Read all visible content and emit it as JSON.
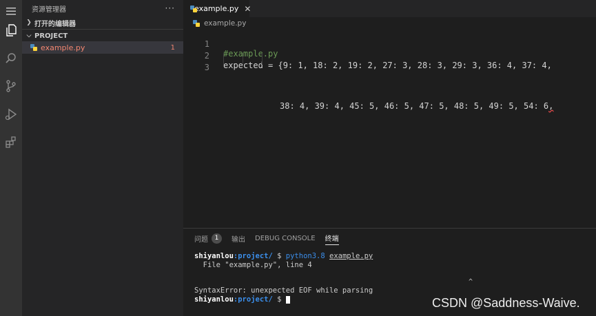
{
  "activity_bar": {
    "icons": [
      "menu-icon",
      "files-icon",
      "search-icon",
      "source-control-icon",
      "run-debug-icon",
      "extensions-icon"
    ]
  },
  "sidebar": {
    "title": "资源管理器",
    "more": "···",
    "open_editors_label": "打开的编辑器",
    "project_label": "PROJECT",
    "file": {
      "name": "example.py",
      "problem_count": "1"
    }
  },
  "tab": {
    "label": "example.py",
    "close": "✕"
  },
  "breadcrumb": {
    "label": "example.py"
  },
  "editor": {
    "lines": [
      {
        "number": "1",
        "text": "#example.py"
      },
      {
        "number": "2",
        "text": "expected = {9: 1, 18: 2, 19: 2, 27: 3, 28: 3, 29: 3, 36: 4, 37: 4,"
      },
      {
        "number": "3",
        "text": "38: 4, 39: 4, 45: 5, 46: 5, 47: 5, 48: 5, 49: 5, 54: 6",
        "tail": ","
      }
    ]
  },
  "panel": {
    "tabs": [
      {
        "label": "问题",
        "badge": "1"
      },
      {
        "label": "输出"
      },
      {
        "label": "DEBUG CONSOLE"
      },
      {
        "label": "终端"
      }
    ],
    "terminal": {
      "user": "shiyanlou",
      "path": ":project/",
      "dollar": " $ ",
      "command": "python3.8",
      "arg": "example.py",
      "file_line": "  File \"example.py\", line 4",
      "caret": "^",
      "error": "SyntaxError: unexpected EOF while parsing"
    }
  },
  "watermark": {
    "text": "CSDN @Saddness-Waive."
  },
  "colors": {
    "error": "#f48771",
    "comment": "#6a9955",
    "prompt_path": "#3b8eea"
  }
}
